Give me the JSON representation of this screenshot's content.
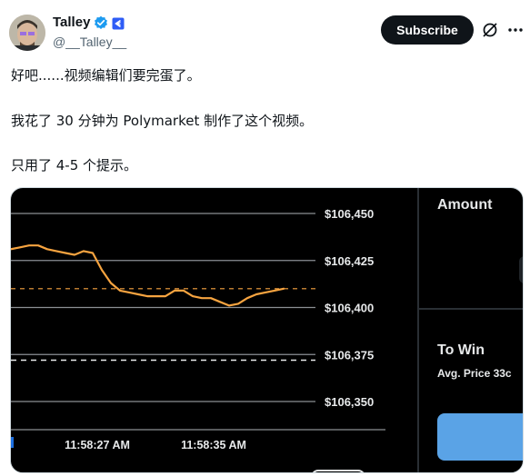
{
  "author": {
    "display_name": "Talley",
    "handle": "@__Talley__"
  },
  "actions": {
    "subscribe_label": "Subscribe"
  },
  "icons": {
    "verified": "verified-check-icon",
    "affiliate": "affiliate-badge-icon",
    "grok": "grok-icon",
    "more": "more-dots-icon"
  },
  "tweet": {
    "line1": "好吧......视频编辑们要完蛋了。",
    "line2": "我花了 30 分钟为 Polymarket 制作了这个视频。",
    "line3": "只用了 4-5 个提示。"
  },
  "media": {
    "right_panel": {
      "amount_label": "Amount",
      "to_win_label": "To Win",
      "avg_price_label": "Avg. Price 33c"
    }
  },
  "chart_data": {
    "type": "line",
    "ylim": [
      106340,
      106460
    ],
    "y_ticks": [
      "$106,450",
      "$106,425",
      "$106,400",
      "$106,375",
      "$106,350"
    ],
    "y_tick_values": [
      106450,
      106425,
      106400,
      106375,
      106350
    ],
    "x_ticks": [
      "11:58:27 AM",
      "11:58:35 AM"
    ],
    "target_line": 106410,
    "dashed_line": 106372,
    "series": [
      {
        "color": "#f7a440",
        "values": [
          106431,
          106432,
          106433,
          106433,
          106431,
          106430,
          106429,
          106428,
          106430,
          106429,
          106420,
          106413,
          106409,
          106408,
          106407,
          106406,
          106406,
          106406,
          106409,
          106409,
          106406,
          106405,
          106405,
          106403,
          106401,
          106402,
          106405,
          106407,
          106408,
          106409,
          106410
        ]
      }
    ]
  },
  "colors": {
    "subscribe_bg": "#0f1419",
    "verified_blue": "#1d9bf0",
    "chart_line": "#f7a440",
    "panel_button": "#5aa3e6"
  }
}
